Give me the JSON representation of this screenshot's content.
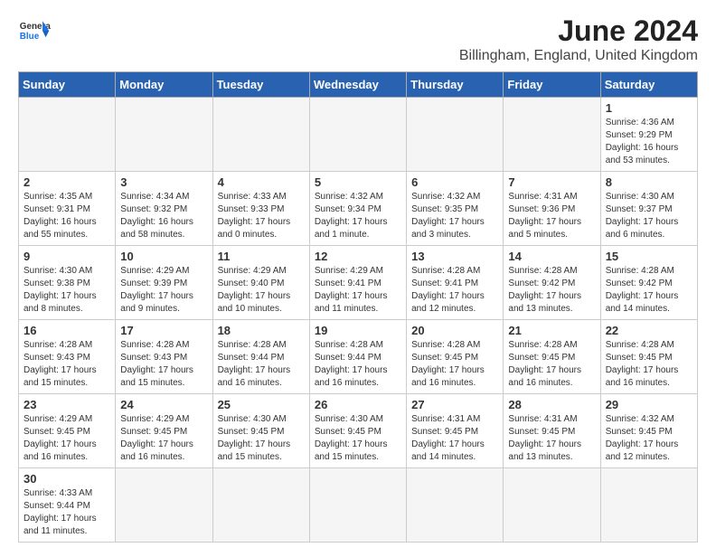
{
  "header": {
    "logo_general": "General",
    "logo_blue": "Blue",
    "main_title": "June 2024",
    "sub_title": "Billingham, England, United Kingdom"
  },
  "weekdays": [
    "Sunday",
    "Monday",
    "Tuesday",
    "Wednesday",
    "Thursday",
    "Friday",
    "Saturday"
  ],
  "weeks": [
    [
      {
        "day": "",
        "empty": true
      },
      {
        "day": "",
        "empty": true
      },
      {
        "day": "",
        "empty": true
      },
      {
        "day": "",
        "empty": true
      },
      {
        "day": "",
        "empty": true
      },
      {
        "day": "",
        "empty": true
      },
      {
        "day": "1",
        "sunrise": "Sunrise: 4:36 AM",
        "sunset": "Sunset: 9:29 PM",
        "daylight": "Daylight: 16 hours and 53 minutes."
      }
    ],
    [
      {
        "day": "2",
        "sunrise": "Sunrise: 4:35 AM",
        "sunset": "Sunset: 9:31 PM",
        "daylight": "Daylight: 16 hours and 55 minutes."
      },
      {
        "day": "3",
        "sunrise": "Sunrise: 4:34 AM",
        "sunset": "Sunset: 9:32 PM",
        "daylight": "Daylight: 16 hours and 58 minutes."
      },
      {
        "day": "4",
        "sunrise": "Sunrise: 4:33 AM",
        "sunset": "Sunset: 9:33 PM",
        "daylight": "Daylight: 17 hours and 0 minutes."
      },
      {
        "day": "5",
        "sunrise": "Sunrise: 4:32 AM",
        "sunset": "Sunset: 9:34 PM",
        "daylight": "Daylight: 17 hours and 1 minute."
      },
      {
        "day": "6",
        "sunrise": "Sunrise: 4:32 AM",
        "sunset": "Sunset: 9:35 PM",
        "daylight": "Daylight: 17 hours and 3 minutes."
      },
      {
        "day": "7",
        "sunrise": "Sunrise: 4:31 AM",
        "sunset": "Sunset: 9:36 PM",
        "daylight": "Daylight: 17 hours and 5 minutes."
      },
      {
        "day": "8",
        "sunrise": "Sunrise: 4:30 AM",
        "sunset": "Sunset: 9:37 PM",
        "daylight": "Daylight: 17 hours and 6 minutes."
      }
    ],
    [
      {
        "day": "9",
        "sunrise": "Sunrise: 4:30 AM",
        "sunset": "Sunset: 9:38 PM",
        "daylight": "Daylight: 17 hours and 8 minutes."
      },
      {
        "day": "10",
        "sunrise": "Sunrise: 4:29 AM",
        "sunset": "Sunset: 9:39 PM",
        "daylight": "Daylight: 17 hours and 9 minutes."
      },
      {
        "day": "11",
        "sunrise": "Sunrise: 4:29 AM",
        "sunset": "Sunset: 9:40 PM",
        "daylight": "Daylight: 17 hours and 10 minutes."
      },
      {
        "day": "12",
        "sunrise": "Sunrise: 4:29 AM",
        "sunset": "Sunset: 9:41 PM",
        "daylight": "Daylight: 17 hours and 11 minutes."
      },
      {
        "day": "13",
        "sunrise": "Sunrise: 4:28 AM",
        "sunset": "Sunset: 9:41 PM",
        "daylight": "Daylight: 17 hours and 12 minutes."
      },
      {
        "day": "14",
        "sunrise": "Sunrise: 4:28 AM",
        "sunset": "Sunset: 9:42 PM",
        "daylight": "Daylight: 17 hours and 13 minutes."
      },
      {
        "day": "15",
        "sunrise": "Sunrise: 4:28 AM",
        "sunset": "Sunset: 9:42 PM",
        "daylight": "Daylight: 17 hours and 14 minutes."
      }
    ],
    [
      {
        "day": "16",
        "sunrise": "Sunrise: 4:28 AM",
        "sunset": "Sunset: 9:43 PM",
        "daylight": "Daylight: 17 hours and 15 minutes."
      },
      {
        "day": "17",
        "sunrise": "Sunrise: 4:28 AM",
        "sunset": "Sunset: 9:43 PM",
        "daylight": "Daylight: 17 hours and 15 minutes."
      },
      {
        "day": "18",
        "sunrise": "Sunrise: 4:28 AM",
        "sunset": "Sunset: 9:44 PM",
        "daylight": "Daylight: 17 hours and 16 minutes."
      },
      {
        "day": "19",
        "sunrise": "Sunrise: 4:28 AM",
        "sunset": "Sunset: 9:44 PM",
        "daylight": "Daylight: 17 hours and 16 minutes."
      },
      {
        "day": "20",
        "sunrise": "Sunrise: 4:28 AM",
        "sunset": "Sunset: 9:45 PM",
        "daylight": "Daylight: 17 hours and 16 minutes."
      },
      {
        "day": "21",
        "sunrise": "Sunrise: 4:28 AM",
        "sunset": "Sunset: 9:45 PM",
        "daylight": "Daylight: 17 hours and 16 minutes."
      },
      {
        "day": "22",
        "sunrise": "Sunrise: 4:28 AM",
        "sunset": "Sunset: 9:45 PM",
        "daylight": "Daylight: 17 hours and 16 minutes."
      }
    ],
    [
      {
        "day": "23",
        "sunrise": "Sunrise: 4:29 AM",
        "sunset": "Sunset: 9:45 PM",
        "daylight": "Daylight: 17 hours and 16 minutes."
      },
      {
        "day": "24",
        "sunrise": "Sunrise: 4:29 AM",
        "sunset": "Sunset: 9:45 PM",
        "daylight": "Daylight: 17 hours and 16 minutes."
      },
      {
        "day": "25",
        "sunrise": "Sunrise: 4:30 AM",
        "sunset": "Sunset: 9:45 PM",
        "daylight": "Daylight: 17 hours and 15 minutes."
      },
      {
        "day": "26",
        "sunrise": "Sunrise: 4:30 AM",
        "sunset": "Sunset: 9:45 PM",
        "daylight": "Daylight: 17 hours and 15 minutes."
      },
      {
        "day": "27",
        "sunrise": "Sunrise: 4:31 AM",
        "sunset": "Sunset: 9:45 PM",
        "daylight": "Daylight: 17 hours and 14 minutes."
      },
      {
        "day": "28",
        "sunrise": "Sunrise: 4:31 AM",
        "sunset": "Sunset: 9:45 PM",
        "daylight": "Daylight: 17 hours and 13 minutes."
      },
      {
        "day": "29",
        "sunrise": "Sunrise: 4:32 AM",
        "sunset": "Sunset: 9:45 PM",
        "daylight": "Daylight: 17 hours and 12 minutes."
      }
    ],
    [
      {
        "day": "30",
        "sunrise": "Sunrise: 4:33 AM",
        "sunset": "Sunset: 9:44 PM",
        "daylight": "Daylight: 17 hours and 11 minutes."
      },
      {
        "day": "",
        "empty": true
      },
      {
        "day": "",
        "empty": true
      },
      {
        "day": "",
        "empty": true
      },
      {
        "day": "",
        "empty": true
      },
      {
        "day": "",
        "empty": true
      },
      {
        "day": "",
        "empty": true
      }
    ]
  ]
}
